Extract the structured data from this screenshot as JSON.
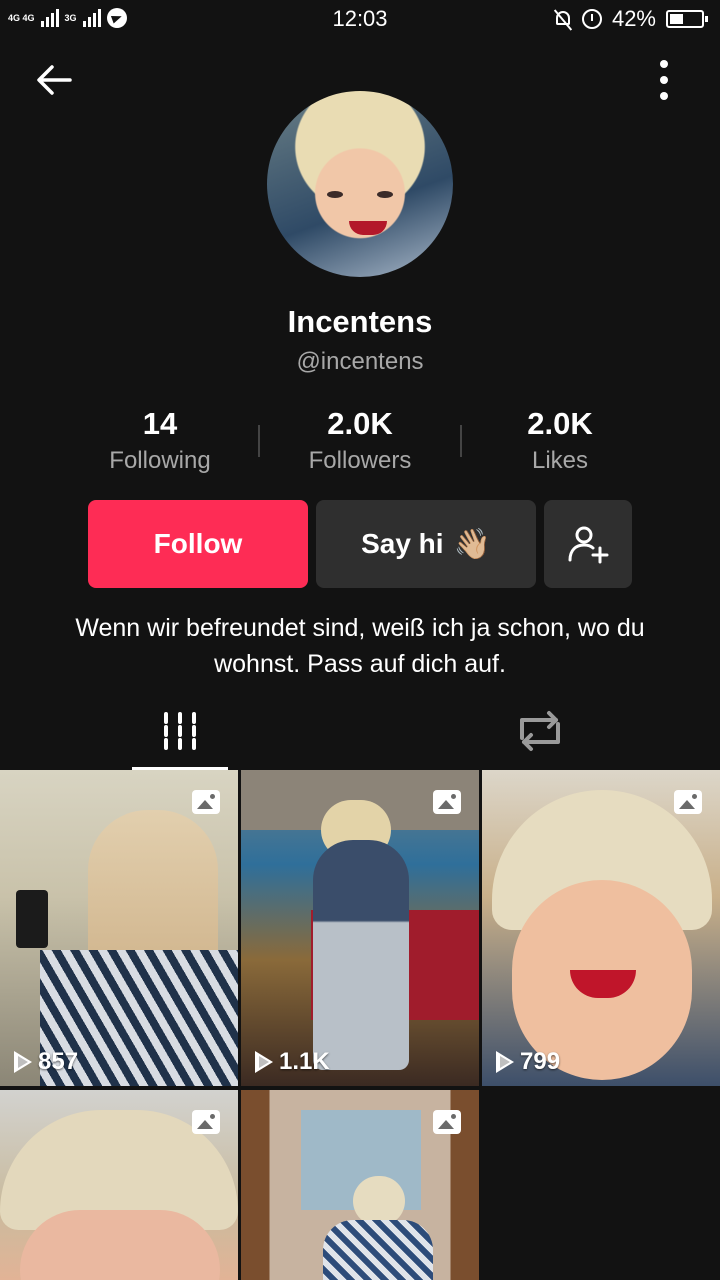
{
  "status_bar": {
    "network_left": "4G 4G",
    "network_right": "3G",
    "time": "12:03",
    "battery_percent": "42%",
    "battery_level": 0.42
  },
  "header": {
    "back_icon": "arrow-left-icon",
    "more_icon": "vertical-dots-icon"
  },
  "profile": {
    "display_name": "Incentens",
    "username": "@incentens",
    "bio": "Wenn wir befreundet sind, weiß ich ja schon, wo du wohnst. Pass auf dich auf."
  },
  "stats": [
    {
      "value": "14",
      "label": "Following"
    },
    {
      "value": "2.0K",
      "label": "Followers"
    },
    {
      "value": "2.0K",
      "label": "Likes"
    }
  ],
  "actions": {
    "follow_label": "Follow",
    "sayhi_label": "Say hi",
    "sayhi_emoji": "👋🏼",
    "add_friend_icon": "add-user-icon"
  },
  "tabs": [
    {
      "name": "videos",
      "icon": "grid-bars-icon",
      "active": true
    },
    {
      "name": "reposts",
      "icon": "repost-icon",
      "active": false
    }
  ],
  "videos": [
    {
      "views": "857"
    },
    {
      "views": "1.1K"
    },
    {
      "views": "799"
    },
    {
      "views": ""
    },
    {
      "views": ""
    }
  ],
  "colors": {
    "background": "#121212",
    "follow_button": "#fe2c55",
    "secondary_button": "#2f2f2f",
    "muted_text": "#a8a8a8"
  }
}
